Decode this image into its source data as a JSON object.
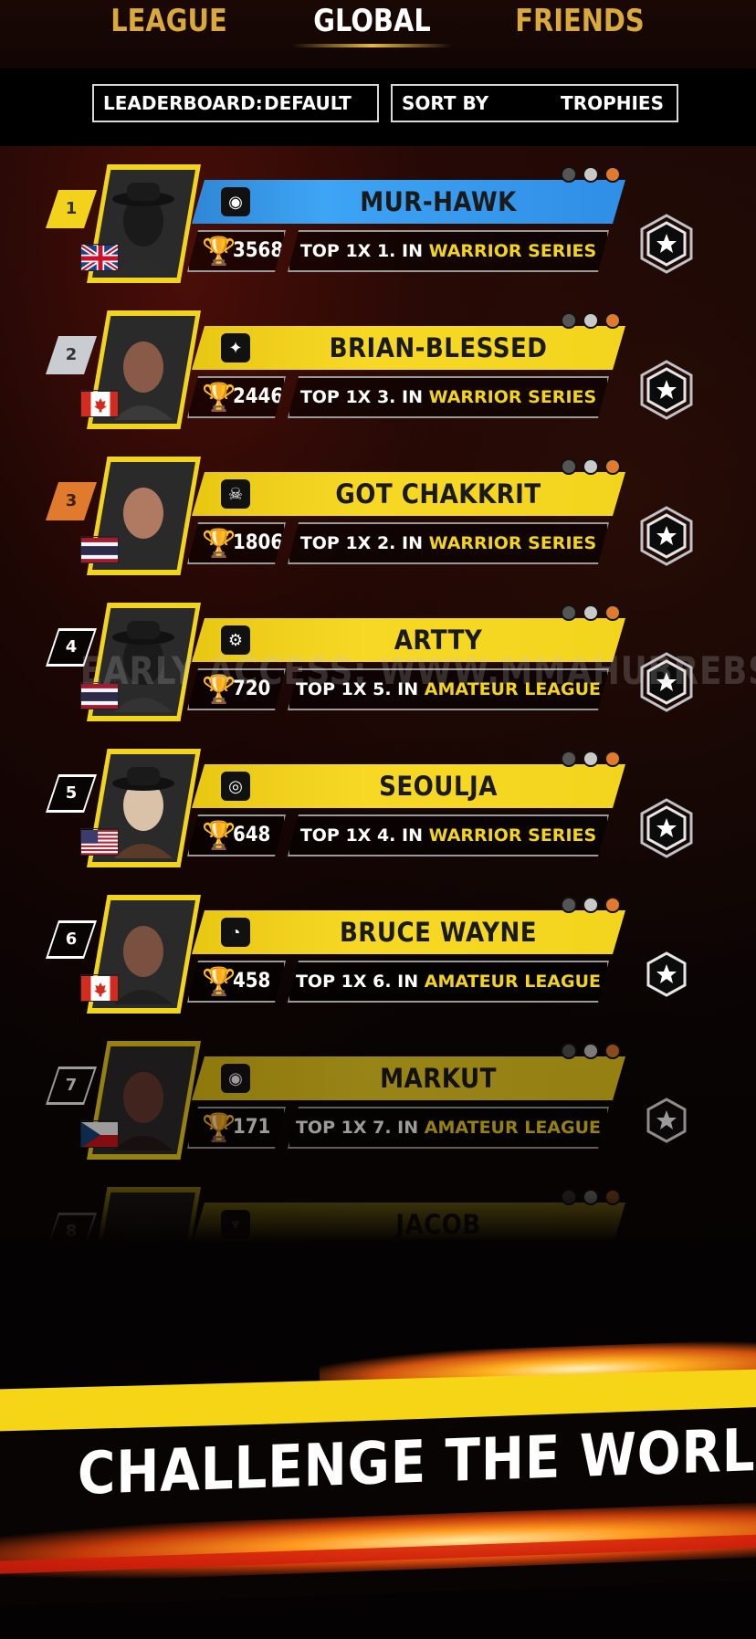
{
  "tabs": [
    {
      "label": "LEAGUE",
      "active": false
    },
    {
      "label": "GLOBAL",
      "active": true
    },
    {
      "label": "FRIENDS",
      "active": false
    }
  ],
  "filters": {
    "leaderboard_label": "LEADERBOARD:",
    "leaderboard_value": "DEFAULT",
    "sort_label": "SORT BY",
    "sort_value": "TROPHIES"
  },
  "players": [
    {
      "rank": "1",
      "name": "MUR-HAWK",
      "trophies": "3568",
      "top_prefix": "TOP 1X 1. IN",
      "league": "WARRIOR SERIES",
      "flag": "uk",
      "clan_icon": "clan-mask-icon",
      "bar": "blue"
    },
    {
      "rank": "2",
      "name": "BRIAN-BLESSED",
      "trophies": "2446",
      "top_prefix": "TOP 1X 3. IN",
      "league": "WARRIOR SERIES",
      "flag": "canada",
      "clan_icon": "clan-fox-icon",
      "bar": "yellow"
    },
    {
      "rank": "3",
      "name": "GOT CHAKKRIT",
      "trophies": "1806",
      "top_prefix": "TOP 1X 2. IN",
      "league": "WARRIOR SERIES",
      "flag": "thailand",
      "clan_icon": "clan-skull-icon",
      "bar": "yellow"
    },
    {
      "rank": "4",
      "name": "ARTTY",
      "trophies": "720",
      "top_prefix": "TOP 1X 5. IN",
      "league": "AMATEUR LEAGUE",
      "flag": "thailand",
      "clan_icon": "clan-gear-icon",
      "bar": "yellow"
    },
    {
      "rank": "5",
      "name": "SEOULJA",
      "trophies": "648",
      "top_prefix": "TOP 1X 4. IN",
      "league": "WARRIOR SERIES",
      "flag": "usa",
      "clan_icon": "clan-ring-icon",
      "bar": "yellow"
    },
    {
      "rank": "6",
      "name": "BRUCE WAYNE",
      "trophies": "458",
      "top_prefix": "TOP 1X 6. IN",
      "league": "AMATEUR LEAGUE",
      "flag": "canada",
      "clan_icon": "clan-gauge-icon",
      "bar": "yellow"
    },
    {
      "rank": "7",
      "name": "MARKUT",
      "trophies": "171",
      "top_prefix": "TOP 1X 7. IN",
      "league": "AMATEUR LEAGUE",
      "flag": "czech",
      "clan_icon": "clan-mask-icon",
      "bar": "yellow"
    },
    {
      "rank": "8",
      "name": "JACOB",
      "clan_icon": "clan-devil-icon",
      "bar": "yellow"
    }
  ],
  "watermark": "EARLY ACCESS: WWW.MMAHUBREBS",
  "banner": {
    "headline": "CHALLENGE THE WORLD"
  },
  "colors": {
    "gold": "#f3d41d",
    "blue": "#3ea4f4",
    "tab_inactive": "#d9a93a",
    "tab_active": "#ffffff"
  }
}
